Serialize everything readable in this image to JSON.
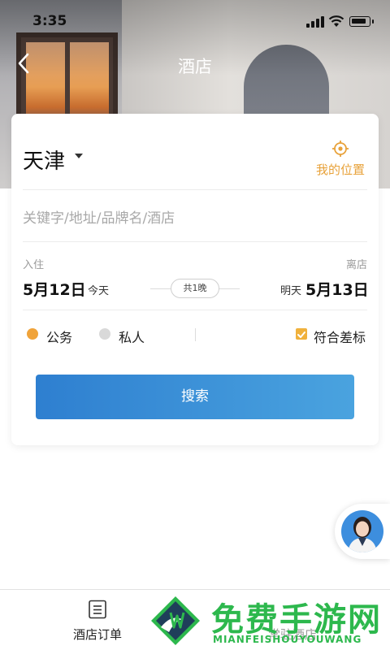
{
  "status_bar": {
    "time": "3:35"
  },
  "nav": {
    "title": "酒店"
  },
  "search_card": {
    "city": "天津",
    "my_location_label": "我的位置",
    "keyword_placeholder": "关键字/地址/品牌名/酒店",
    "checkin": {
      "label": "入住",
      "date": "5月12日",
      "day": "今天"
    },
    "checkout": {
      "label": "离店",
      "date": "5月13日",
      "day": "明天"
    },
    "nights": "共1晚",
    "trip_types": [
      {
        "label": "公务",
        "selected": true,
        "color": "#f0a33a"
      },
      {
        "label": "私人",
        "selected": false,
        "color": "#d9d9d9"
      }
    ],
    "policy_checkbox": {
      "label": "符合差标",
      "checked": true
    },
    "search_button": "搜索"
  },
  "tab_bar": {
    "tabs": [
      {
        "label": "酒店订单"
      },
      {
        "label": "常驻酒店"
      }
    ]
  },
  "watermark": {
    "text": "免费手游网",
    "subtext": "MIANFEISHOUYOUWANG"
  },
  "colors": {
    "accent": "#e8a23a",
    "primary": "#2e7fd0",
    "watermark": "#2db84d"
  }
}
